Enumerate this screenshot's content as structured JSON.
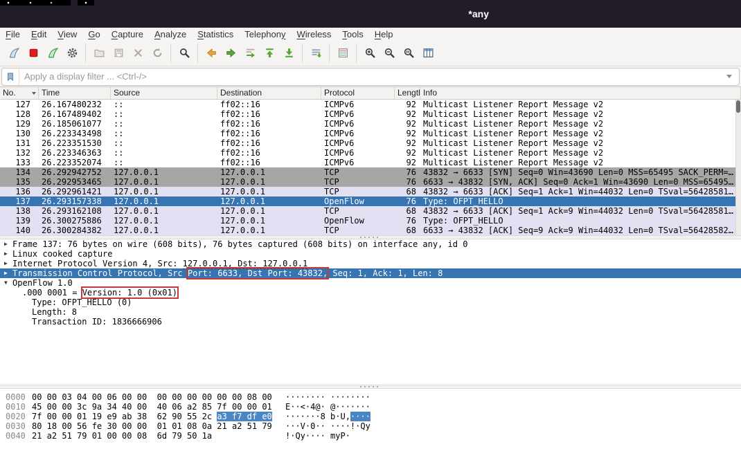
{
  "window": {
    "title": "*any"
  },
  "colors": {
    "title_bar": "#211c28",
    "toolbar_bg": "#f5f4f2",
    "selection": "#3674b2",
    "selection_hex": "#4a86c5",
    "row_gray": "#a6a6a6",
    "row_lavender": "#e2e1f3",
    "annotation_red": "#c43b3b"
  },
  "menu": {
    "items": [
      {
        "label": "File",
        "mnemonic": 0
      },
      {
        "label": "Edit",
        "mnemonic": 0
      },
      {
        "label": "View",
        "mnemonic": 0
      },
      {
        "label": "Go",
        "mnemonic": 0
      },
      {
        "label": "Capture",
        "mnemonic": 0
      },
      {
        "label": "Analyze",
        "mnemonic": 0
      },
      {
        "label": "Statistics",
        "mnemonic": 0
      },
      {
        "label": "Telephony",
        "mnemonic": 8
      },
      {
        "label": "Wireless",
        "mnemonic": 0
      },
      {
        "label": "Tools",
        "mnemonic": 0
      },
      {
        "label": "Help",
        "mnemonic": 0
      }
    ]
  },
  "toolbar": {
    "groups": [
      [
        "capture-start",
        "capture-stop",
        "capture-restart",
        "capture-options"
      ],
      [
        "file-open",
        "file-save",
        "file-close",
        "reload"
      ],
      [
        "find"
      ],
      [
        "go-back",
        "go-forward",
        "go-to-packet",
        "go-top",
        "go-bottom"
      ],
      [
        "auto-scroll"
      ],
      [
        "colorize"
      ],
      [
        "zoom-in",
        "zoom-out",
        "zoom-original",
        "resize-columns"
      ]
    ]
  },
  "filter": {
    "placeholder": "Apply a display filter ... <Ctrl-/>"
  },
  "packet_list": {
    "columns": [
      "No.",
      "Time",
      "Source",
      "Destination",
      "Protocol",
      "Length",
      "Info"
    ],
    "rows": [
      {
        "no": "127",
        "time": "26.167480232",
        "source": "::",
        "destination": "ff02::16",
        "protocol": "ICMPv6",
        "length": "92",
        "info": "Multicast Listener Report Message v2",
        "style": "plain"
      },
      {
        "no": "128",
        "time": "26.167489402",
        "source": "::",
        "destination": "ff02::16",
        "protocol": "ICMPv6",
        "length": "92",
        "info": "Multicast Listener Report Message v2",
        "style": "plain"
      },
      {
        "no": "129",
        "time": "26.185061077",
        "source": "::",
        "destination": "ff02::16",
        "protocol": "ICMPv6",
        "length": "92",
        "info": "Multicast Listener Report Message v2",
        "style": "plain"
      },
      {
        "no": "130",
        "time": "26.223343498",
        "source": "::",
        "destination": "ff02::16",
        "protocol": "ICMPv6",
        "length": "92",
        "info": "Multicast Listener Report Message v2",
        "style": "plain"
      },
      {
        "no": "131",
        "time": "26.223351530",
        "source": "::",
        "destination": "ff02::16",
        "protocol": "ICMPv6",
        "length": "92",
        "info": "Multicast Listener Report Message v2",
        "style": "plain"
      },
      {
        "no": "132",
        "time": "26.223346363",
        "source": "::",
        "destination": "ff02::16",
        "protocol": "ICMPv6",
        "length": "92",
        "info": "Multicast Listener Report Message v2",
        "style": "plain"
      },
      {
        "no": "133",
        "time": "26.223352074",
        "source": "::",
        "destination": "ff02::16",
        "protocol": "ICMPv6",
        "length": "92",
        "info": "Multicast Listener Report Message v2",
        "style": "plain"
      },
      {
        "no": "134",
        "time": "26.292942752",
        "source": "127.0.0.1",
        "destination": "127.0.0.1",
        "protocol": "TCP",
        "length": "76",
        "info": "43832 → 6633 [SYN] Seq=0 Win=43690 Len=0 MSS=65495 SACK_PERM=…",
        "style": "gray"
      },
      {
        "no": "135",
        "time": "26.292953465",
        "source": "127.0.0.1",
        "destination": "127.0.0.1",
        "protocol": "TCP",
        "length": "76",
        "info": "6633 → 43832 [SYN, ACK] Seq=0 Ack=1 Win=43690 Len=0 MSS=65495…",
        "style": "gray"
      },
      {
        "no": "136",
        "time": "26.292961421",
        "source": "127.0.0.1",
        "destination": "127.0.0.1",
        "protocol": "TCP",
        "length": "68",
        "info": "43832 → 6633 [ACK] Seq=1 Ack=1 Win=44032 Len=0 TSval=56428581…",
        "style": "lavender"
      },
      {
        "no": "137",
        "time": "26.293157338",
        "source": "127.0.0.1",
        "destination": "127.0.0.1",
        "protocol": "OpenFlow",
        "length": "76",
        "info": "Type: OFPT_HELLO",
        "style": "selected"
      },
      {
        "no": "138",
        "time": "26.293162108",
        "source": "127.0.0.1",
        "destination": "127.0.0.1",
        "protocol": "TCP",
        "length": "68",
        "info": "43832 → 6633 [ACK] Seq=1 Ack=9 Win=44032 Len=0 TSval=56428581…",
        "style": "lavender"
      },
      {
        "no": "139",
        "time": "26.300275886",
        "source": "127.0.0.1",
        "destination": "127.0.0.1",
        "protocol": "OpenFlow",
        "length": "76",
        "info": "Type: OFPT_HELLO",
        "style": "lavender"
      },
      {
        "no": "140",
        "time": "26.300284382",
        "source": "127.0.0.1",
        "destination": "127.0.0.1",
        "protocol": "TCP",
        "length": "68",
        "info": "6633 → 43832 [ACK] Seq=9 Ack=9 Win=44032 Len=0 TSval=56428582…",
        "style": "lavender"
      }
    ]
  },
  "details": {
    "lines": [
      {
        "arrow": "collapsed",
        "indent": 0,
        "selected": false,
        "segments": [
          {
            "text": "Frame 137: 76 bytes on wire (608 bits), 76 bytes captured (608 bits) on interface any, id 0"
          }
        ]
      },
      {
        "arrow": "collapsed",
        "indent": 0,
        "selected": false,
        "segments": [
          {
            "text": "Linux cooked capture"
          }
        ]
      },
      {
        "arrow": "collapsed",
        "indent": 0,
        "selected": false,
        "segments": [
          {
            "text": "Internet Protocol Version 4, Src: "
          },
          {
            "text": "127.0.0.1, Dst: 127.0.0.1",
            "underline": true
          }
        ]
      },
      {
        "arrow": "collapsed",
        "indent": 0,
        "selected": true,
        "segments": [
          {
            "text": "Transmission Control Protocol, Src "
          },
          {
            "text": "Port: 6633, Dst Port: 43832,",
            "redbox": true
          },
          {
            "text": " Seq: 1, Ack: 1, Len: 8"
          }
        ]
      },
      {
        "arrow": "expanded",
        "indent": 0,
        "selected": false,
        "segments": [
          {
            "text": "OpenFlow 1.0"
          }
        ]
      },
      {
        "arrow": "none",
        "indent": 1,
        "selected": false,
        "segments": [
          {
            "text": ".000 0001 = "
          },
          {
            "text": "Version: 1.0 (0x01)",
            "redbox": true
          }
        ]
      },
      {
        "arrow": "none",
        "indent": 2,
        "selected": false,
        "segments": [
          {
            "text": "Type: OFPT_HELLO (0)"
          }
        ]
      },
      {
        "arrow": "none",
        "indent": 2,
        "selected": false,
        "segments": [
          {
            "text": "Length: 8"
          }
        ]
      },
      {
        "arrow": "none",
        "indent": 2,
        "selected": false,
        "segments": [
          {
            "text": "Transaction ID: 1836666906"
          }
        ]
      }
    ]
  },
  "hex": {
    "rows": [
      {
        "offset": "0000",
        "hex": [
          {
            "text": "00 00 03 04 00 06 00 00  00 00 00 00 00 00 08 00"
          }
        ],
        "ascii": [
          {
            "text": "········ ········"
          }
        ]
      },
      {
        "offset": "0010",
        "hex": [
          {
            "text": "45 00 00 3c 9a 34 40 00  40 06 a2 85 7f 00 00 01"
          }
        ],
        "ascii": [
          {
            "text": "E··<·4@· @·······"
          }
        ]
      },
      {
        "offset": "0020",
        "hex": [
          {
            "text": "7f 00 00 01 19 e9 ab 38  62 90 55 2c "
          },
          {
            "text": "a3 f7 df e0",
            "selected": true
          }
        ],
        "ascii": [
          {
            "text": "·······8 b·U,"
          },
          {
            "text": "····",
            "selected": true
          }
        ]
      },
      {
        "offset": "0030",
        "hex": [
          {
            "text": "80 18 00 56 fe 30 00 00  01 01 08 0a 21 a2 51 79"
          }
        ],
        "ascii": [
          {
            "text": "···V·0·· ····!·Qy"
          }
        ]
      },
      {
        "offset": "0040",
        "hex": [
          {
            "text": "21 a2 51 79 01 00 00 08  6d 79 50 1a"
          }
        ],
        "ascii": [
          {
            "text": "!·Qy···· myP·"
          }
        ]
      }
    ]
  }
}
